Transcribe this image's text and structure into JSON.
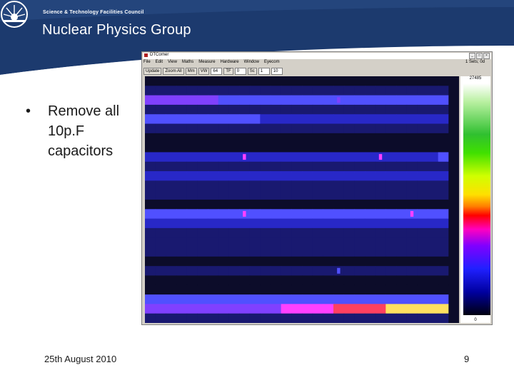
{
  "header": {
    "council": "Science & Technology Facilities Council",
    "group": "Nuclear Physics Group",
    "colors": {
      "band": "#1c3a6e",
      "band_light": "#4a6a9c"
    },
    "logo_icon": "stfc-sunburst-icon"
  },
  "bullet": {
    "marker": "•",
    "text": "Remove all 10p.F capacitors"
  },
  "footer": {
    "date": "25th August 2010",
    "page": "9"
  },
  "app": {
    "title": "DTCorner",
    "window_buttons": [
      "_",
      "□",
      "×"
    ],
    "menu": [
      "File",
      "Edit",
      "View",
      "Maths",
      "Measure",
      "Hardware",
      "Window",
      "Eyecom"
    ],
    "toolbar": {
      "update": "Update",
      "zoom_all": "Zoom All",
      "mm": "Mm",
      "vw": "VW",
      "field1": "64",
      "tr": "TF",
      "field2": "0",
      "sc": "Sc",
      "field3": "1",
      "field4": "10"
    },
    "status": "1 Sets; 0d",
    "palette": {
      "max_label": "27485",
      "min_label": "0"
    },
    "heatmap": {
      "band_colors": [
        "#0c0c2a",
        "#191970",
        "#2828c8",
        "#5050ff",
        "#8040ff",
        "#ff40ff",
        "#ff4060",
        "#ffe060"
      ],
      "rows": [
        [
          0,
          0,
          0,
          0,
          0,
          0,
          0,
          0,
          0,
          0,
          0,
          0,
          0,
          0,
          0,
          0,
          0,
          0,
          0,
          0,
          0,
          0,
          0,
          0,
          0,
          0,
          0,
          0,
          0,
          0
        ],
        [
          1,
          1,
          1,
          1,
          1,
          1,
          1,
          1,
          1,
          1,
          1,
          1,
          1,
          1,
          1,
          1,
          1,
          1,
          1,
          1,
          1,
          1,
          1,
          1,
          1,
          1,
          1,
          1,
          1,
          0
        ],
        [
          4,
          4,
          4,
          4,
          4,
          4,
          4,
          3,
          3,
          3,
          3,
          3,
          3,
          3,
          3,
          3,
          3,
          3,
          3,
          3,
          3,
          3,
          3,
          3,
          3,
          3,
          3,
          3,
          3,
          0
        ],
        [
          1,
          1,
          1,
          1,
          1,
          1,
          1,
          1,
          1,
          1,
          1,
          1,
          1,
          1,
          1,
          1,
          1,
          1,
          1,
          1,
          1,
          1,
          1,
          1,
          1,
          1,
          1,
          1,
          1,
          0
        ],
        [
          3,
          3,
          3,
          3,
          3,
          3,
          3,
          3,
          3,
          3,
          3,
          2,
          2,
          2,
          2,
          2,
          2,
          2,
          2,
          2,
          2,
          2,
          2,
          2,
          2,
          2,
          2,
          2,
          2,
          0
        ],
        [
          1,
          1,
          1,
          1,
          1,
          1,
          1,
          1,
          1,
          1,
          1,
          1,
          1,
          1,
          1,
          1,
          1,
          1,
          1,
          1,
          1,
          1,
          1,
          1,
          1,
          1,
          1,
          1,
          1,
          0
        ],
        [
          0,
          0,
          0,
          0,
          0,
          0,
          0,
          0,
          0,
          0,
          0,
          0,
          0,
          0,
          0,
          0,
          0,
          0,
          0,
          0,
          0,
          0,
          0,
          0,
          0,
          0,
          0,
          0,
          0,
          0
        ],
        [
          0,
          0,
          0,
          0,
          0,
          0,
          0,
          0,
          0,
          0,
          0,
          0,
          0,
          0,
          0,
          0,
          0,
          0,
          0,
          0,
          0,
          0,
          0,
          0,
          0,
          0,
          0,
          0,
          0,
          0
        ],
        [
          2,
          2,
          2,
          2,
          2,
          2,
          2,
          2,
          2,
          2,
          2,
          2,
          2,
          2,
          2,
          2,
          2,
          2,
          2,
          2,
          2,
          2,
          2,
          2,
          2,
          2,
          2,
          2,
          3,
          0
        ],
        [
          1,
          1,
          1,
          1,
          1,
          1,
          1,
          1,
          1,
          1,
          1,
          1,
          1,
          1,
          1,
          1,
          1,
          1,
          1,
          1,
          1,
          1,
          1,
          1,
          1,
          1,
          1,
          1,
          1,
          0
        ],
        [
          2,
          2,
          2,
          2,
          2,
          2,
          2,
          2,
          2,
          2,
          2,
          2,
          2,
          2,
          2,
          2,
          2,
          2,
          2,
          2,
          2,
          2,
          2,
          2,
          2,
          2,
          2,
          2,
          2,
          0
        ],
        [
          1,
          1,
          1,
          1,
          1,
          1,
          1,
          1,
          1,
          1,
          1,
          1,
          1,
          1,
          1,
          1,
          1,
          1,
          1,
          1,
          1,
          1,
          1,
          1,
          1,
          1,
          1,
          1,
          1,
          0
        ],
        [
          1,
          1,
          1,
          1,
          1,
          1,
          1,
          1,
          1,
          1,
          1,
          1,
          1,
          1,
          1,
          1,
          1,
          1,
          1,
          1,
          1,
          1,
          1,
          1,
          1,
          1,
          1,
          1,
          1,
          0
        ],
        [
          0,
          0,
          0,
          0,
          0,
          0,
          0,
          0,
          0,
          0,
          0,
          0,
          0,
          0,
          0,
          0,
          0,
          0,
          0,
          0,
          0,
          0,
          0,
          0,
          0,
          0,
          0,
          0,
          0,
          0
        ],
        [
          3,
          3,
          3,
          3,
          3,
          3,
          3,
          3,
          3,
          3,
          3,
          3,
          3,
          3,
          3,
          3,
          3,
          3,
          3,
          3,
          3,
          3,
          3,
          3,
          3,
          3,
          3,
          3,
          3,
          0
        ],
        [
          2,
          2,
          2,
          2,
          2,
          2,
          2,
          2,
          2,
          2,
          2,
          2,
          2,
          2,
          2,
          2,
          2,
          2,
          2,
          2,
          2,
          2,
          2,
          2,
          2,
          2,
          2,
          2,
          2,
          0
        ],
        [
          1,
          1,
          1,
          1,
          1,
          1,
          1,
          1,
          1,
          1,
          1,
          1,
          1,
          1,
          1,
          1,
          1,
          1,
          1,
          1,
          1,
          1,
          1,
          1,
          1,
          1,
          1,
          1,
          1,
          0
        ],
        [
          1,
          1,
          1,
          1,
          1,
          1,
          1,
          1,
          1,
          1,
          1,
          1,
          1,
          1,
          1,
          1,
          1,
          1,
          1,
          1,
          1,
          1,
          1,
          1,
          1,
          1,
          1,
          1,
          1,
          0
        ],
        [
          1,
          1,
          1,
          1,
          1,
          1,
          1,
          1,
          1,
          1,
          1,
          1,
          1,
          1,
          1,
          1,
          1,
          1,
          1,
          1,
          1,
          1,
          1,
          1,
          1,
          1,
          1,
          1,
          1,
          0
        ],
        [
          0,
          0,
          0,
          0,
          0,
          0,
          0,
          0,
          0,
          0,
          0,
          0,
          0,
          0,
          0,
          0,
          0,
          0,
          0,
          0,
          0,
          0,
          0,
          0,
          0,
          0,
          0,
          0,
          0,
          0
        ],
        [
          1,
          1,
          1,
          1,
          1,
          1,
          1,
          1,
          1,
          1,
          1,
          1,
          1,
          1,
          1,
          1,
          1,
          1,
          1,
          1,
          1,
          1,
          1,
          1,
          1,
          1,
          1,
          1,
          1,
          0
        ],
        [
          0,
          0,
          0,
          0,
          0,
          0,
          0,
          0,
          0,
          0,
          0,
          0,
          0,
          0,
          0,
          0,
          0,
          0,
          0,
          0,
          0,
          0,
          0,
          0,
          0,
          0,
          0,
          0,
          0,
          0
        ],
        [
          0,
          0,
          0,
          0,
          0,
          0,
          0,
          0,
          0,
          0,
          0,
          0,
          0,
          0,
          0,
          0,
          0,
          0,
          0,
          0,
          0,
          0,
          0,
          0,
          0,
          0,
          0,
          0,
          0,
          0
        ],
        [
          3,
          3,
          3,
          3,
          3,
          3,
          3,
          3,
          3,
          3,
          3,
          3,
          3,
          3,
          3,
          3,
          3,
          3,
          3,
          3,
          3,
          3,
          3,
          3,
          3,
          3,
          3,
          3,
          3,
          0
        ],
        [
          4,
          4,
          4,
          4,
          4,
          4,
          4,
          4,
          4,
          4,
          4,
          4,
          4,
          5,
          5,
          5,
          5,
          5,
          6,
          6,
          6,
          6,
          6,
          7,
          7,
          7,
          7,
          7,
          7,
          0
        ],
        [
          1,
          1,
          1,
          1,
          1,
          1,
          1,
          1,
          1,
          1,
          1,
          1,
          1,
          1,
          1,
          1,
          1,
          1,
          1,
          1,
          1,
          1,
          1,
          1,
          1,
          1,
          1,
          1,
          1,
          0
        ]
      ],
      "hot_spots": [
        {
          "row": 2,
          "col": 18,
          "level": 4
        },
        {
          "row": 8,
          "col": 9,
          "level": 5
        },
        {
          "row": 8,
          "col": 22,
          "level": 5
        },
        {
          "row": 14,
          "col": 9,
          "level": 5
        },
        {
          "row": 14,
          "col": 25,
          "level": 5
        },
        {
          "row": 20,
          "col": 18,
          "level": 3
        },
        {
          "row": 24,
          "col": 25,
          "level": 7
        }
      ]
    }
  }
}
